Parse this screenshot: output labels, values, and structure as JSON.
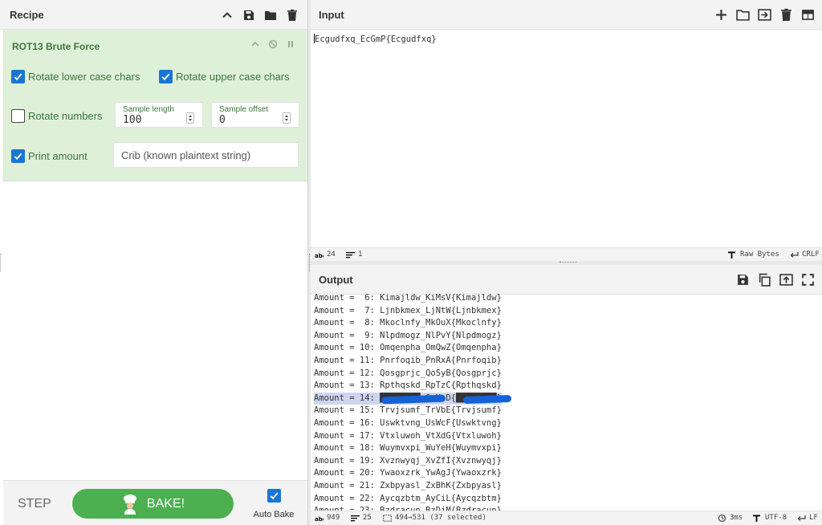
{
  "recipe": {
    "title": "Recipe",
    "operation": {
      "title": "ROT13 Brute Force",
      "rotate_lower": {
        "label": "Rotate lower case chars",
        "checked": true
      },
      "rotate_upper": {
        "label": "Rotate upper case chars",
        "checked": true
      },
      "rotate_numbers": {
        "label": "Rotate numbers",
        "checked": false
      },
      "print_amount": {
        "label": "Print amount",
        "checked": true
      },
      "sample_length": {
        "label": "Sample length",
        "value": "100"
      },
      "sample_offset": {
        "label": "Sample offset",
        "value": "0"
      },
      "crib": {
        "placeholder": "Crib (known plaintext string)"
      }
    },
    "footer": {
      "step_label": "STEP",
      "bake_label": "BAKE!",
      "auto_bake_label": "Auto Bake",
      "auto_bake_checked": true
    }
  },
  "input": {
    "title": "Input",
    "text": "Ecgudfxq_EcGmP{Ecgudfxq}",
    "status": {
      "chars": "24",
      "lines": "1",
      "encoding": "Raw Bytes",
      "eol": "CRLF"
    }
  },
  "output": {
    "title": "Output",
    "lines": [
      "Amount =  6: Kimajldw_KiMsV{Kimajldw}",
      "Amount =  7: Ljnbkmex_LjNtW{Ljnbkmex}",
      "Amount =  8: Mkoclnfy_MkOuX{Mkoclnfy}",
      "Amount =  9: Nlpdmogz_NlPvY{Nlpdmogz}",
      "Amount = 10: Omqenpha_OmQwZ{Omqenpha}",
      "Amount = 11: Pnrfoqib_PnRxA{Pnrfoqib}",
      "Amount = 12: Qosgprjc_QoSyB{Qosgprjc}",
      "Amount = 13: Rpthqskd_RpTzC{Rpthqskd}",
      "Amount = 14: ████████_SqUaD{████████}",
      "Amount = 15: Trvjsumf_TrVbE{Trvjsumf}",
      "Amount = 16: Uswktvng_UsWcF{Uswktvng}",
      "Amount = 17: Vtxluwoh_VtXdG{Vtxluwoh}",
      "Amount = 18: Wuymvxpi_WuYeH{Wuymvxpi}",
      "Amount = 19: Xvznwyqj_XvZfI{Xvznwyqj}",
      "Amount = 20: Ywaoxzrk_YwAgJ{Ywaoxzrk}",
      "Amount = 21: Zxbpyasl_ZxBhK{Zxbpyasl}",
      "Amount = 22: Aycqzbtm_AyCiL{Aycqzbtm}",
      "Amount = 23: Bzdracun_BzDjM{Bzdracun}"
    ],
    "selected_index": 8,
    "status": {
      "chars": "949",
      "lines": "25",
      "selection": "494→531 (37 selected)",
      "time": "3ms",
      "encoding": "UTF-8",
      "eol": "LF"
    }
  },
  "colors": {
    "accent": "#1976d2",
    "operation_bg": "#dff0d8",
    "operation_text": "#3c763d",
    "bake_button": "#4caf50",
    "redaction": "#1561d6"
  }
}
